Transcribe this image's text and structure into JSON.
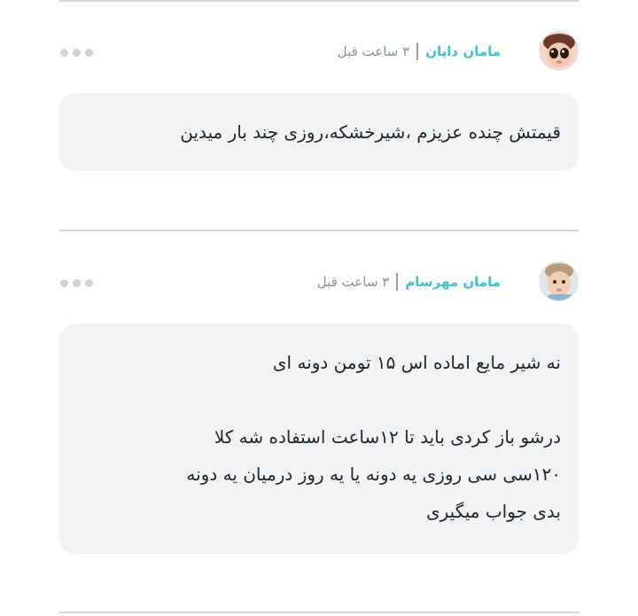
{
  "comments": [
    {
      "author": "مامان دایان",
      "time": "۳ ساعت قبل",
      "avatar_icon": "baby-face-avatar",
      "text": "قیمتش چنده عزیزم ،شیرخشکه،روزی چند بار میدین"
    },
    {
      "author": "مامان مهرسام",
      "time": "۳ ساعت قبل",
      "avatar_icon": "baby-photo-avatar",
      "lines": [
        "نه شیر مایع اماده اس ۱۵ تومن دونه ای",
        "",
        "درشو باز کردی باید تا ۱۲ساعت استفاده شه کلا",
        "۱۲۰سی سی روزی یه دونه یا یه روز درمیان یه دونه",
        "بدی جواب میگیری"
      ]
    }
  ],
  "more_icon": "more-dots-icon"
}
